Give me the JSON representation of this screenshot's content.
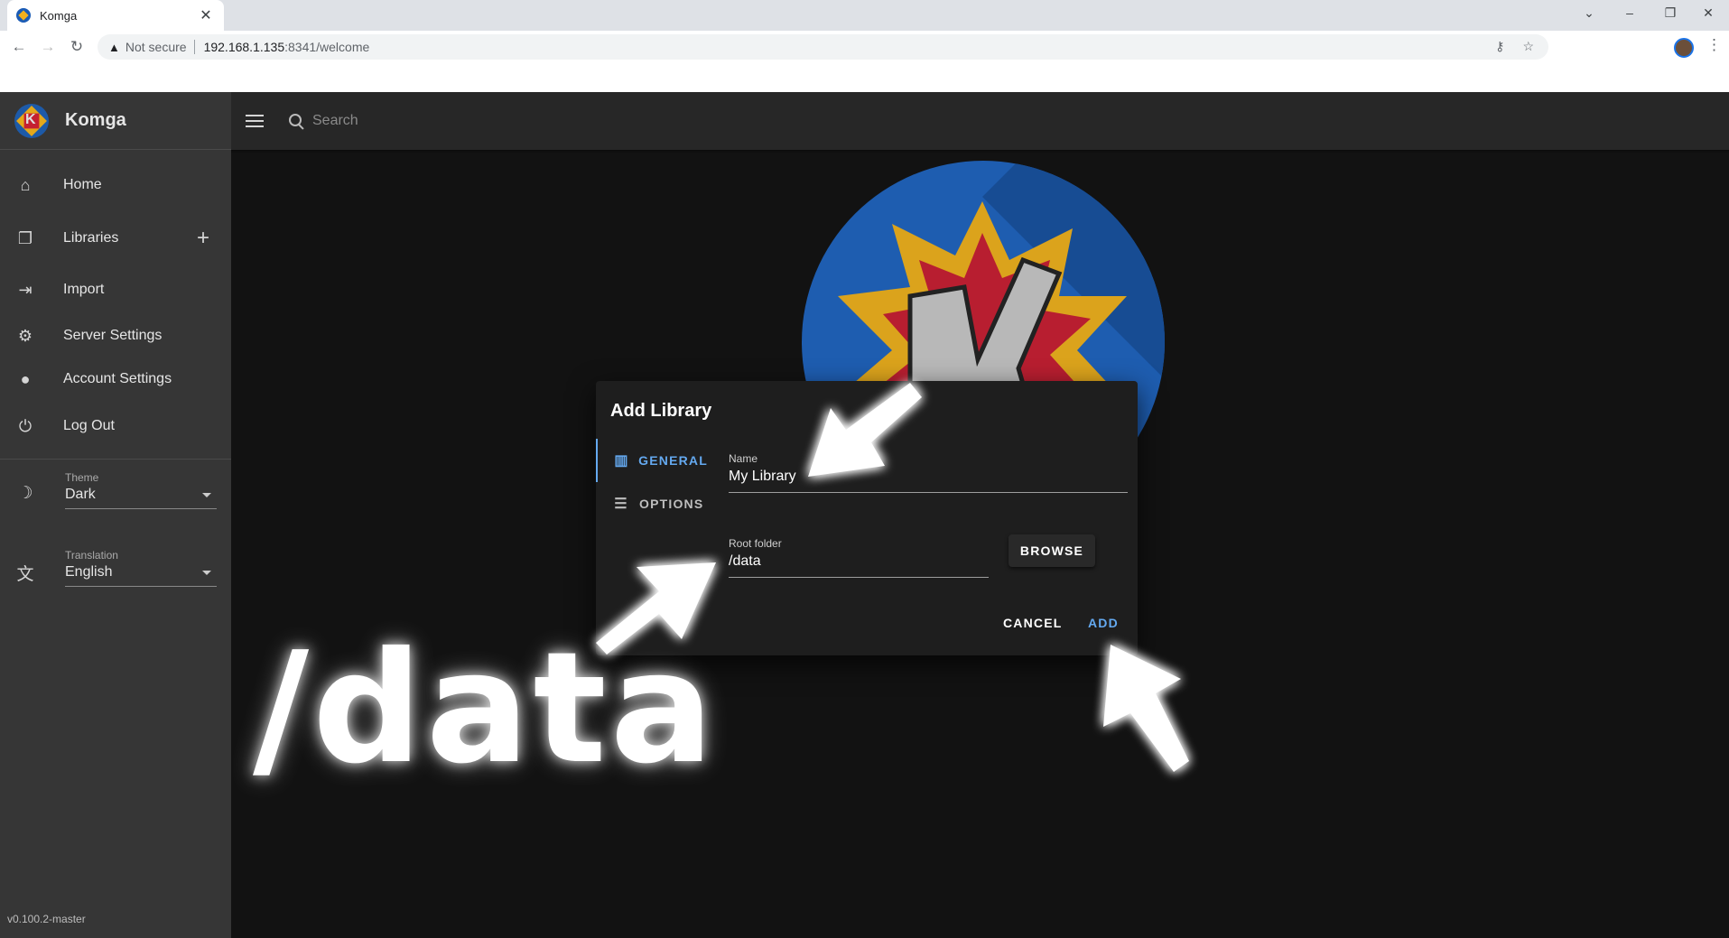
{
  "browser": {
    "tab_title": "Komga",
    "tab_close": "✕",
    "security_label": "Not secure",
    "url_host": "192.168.1.135",
    "url_rest": ":8341/welcome"
  },
  "app": {
    "brand": "Komga",
    "search_placeholder": "Search",
    "nav": [
      {
        "label": "Home",
        "icon": "home-icon"
      },
      {
        "label": "Libraries",
        "icon": "library-icon"
      },
      {
        "label": "Import",
        "icon": "import-icon"
      },
      {
        "label": "Server Settings",
        "icon": "gear-icon"
      },
      {
        "label": "Account Settings",
        "icon": "person-icon"
      },
      {
        "label": "Log Out",
        "icon": "power-icon"
      }
    ],
    "theme": {
      "label": "Theme",
      "value": "Dark"
    },
    "translation": {
      "label": "Translation",
      "value": "English"
    },
    "version": "v0.100.2-master"
  },
  "dialog": {
    "title": "Add Library",
    "tabs": [
      {
        "label": "GENERAL",
        "active": true
      },
      {
        "label": "OPTIONS",
        "active": false
      }
    ],
    "name_label": "Name",
    "name_value": "My Library",
    "root_label": "Root folder",
    "root_value": "/data",
    "browse_label": "BROWSE",
    "cancel_label": "CANCEL",
    "add_label": "ADD"
  },
  "annotation": {
    "big_text": "/data"
  },
  "colors": {
    "accent": "#64a9f0",
    "sidebar": "#363636",
    "appbar": "#272727",
    "background": "#121212",
    "dialog": "#1e1e1e"
  }
}
